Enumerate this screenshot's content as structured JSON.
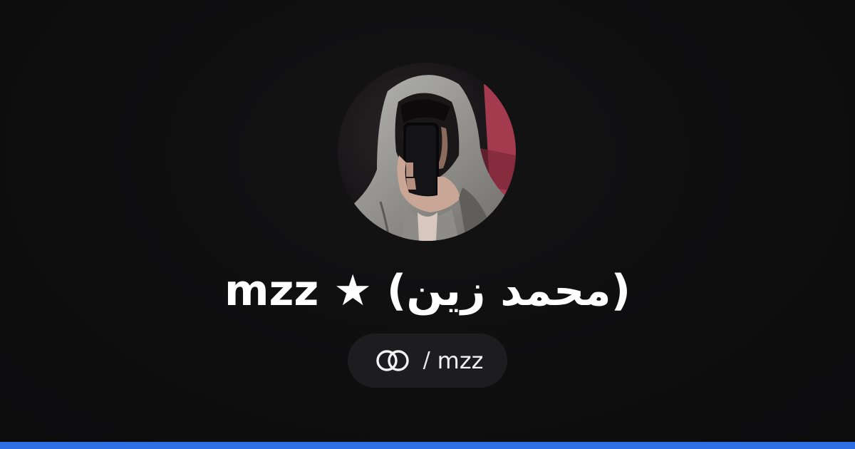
{
  "profile": {
    "display_name": "mzz ★ (محمد زين)",
    "handle_separator": "/",
    "handle": "mzz",
    "avatar_description_icon": "profile-photo"
  },
  "brand": {
    "icon": "interlocked-rings-icon",
    "accent_color": "#2f6fe6",
    "background_color": "#0e0e0f",
    "pill_color": "#1d1d1f",
    "text_color": "#ffffff"
  }
}
